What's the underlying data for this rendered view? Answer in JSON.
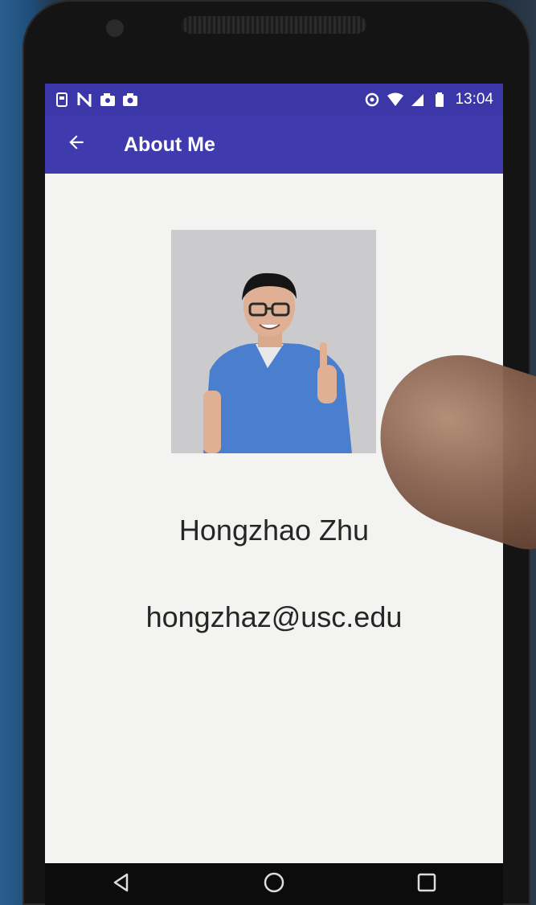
{
  "status_bar": {
    "time": "13:04",
    "left_icons": [
      "sim-icon",
      "n-icon",
      "photo-icon",
      "camera-icon"
    ],
    "right_icons": [
      "data-saver-icon",
      "wifi-icon",
      "signal-icon",
      "battery-icon"
    ]
  },
  "app_bar": {
    "back_icon": "arrow-back-icon",
    "title": "About Me",
    "color": "#3f3aad"
  },
  "profile": {
    "name": "Hongzhao Zhu",
    "email": "hongzhaz@usc.edu"
  },
  "nav_bar": {
    "buttons": [
      "back-triangle-icon",
      "home-circle-icon",
      "recents-square-icon"
    ]
  }
}
